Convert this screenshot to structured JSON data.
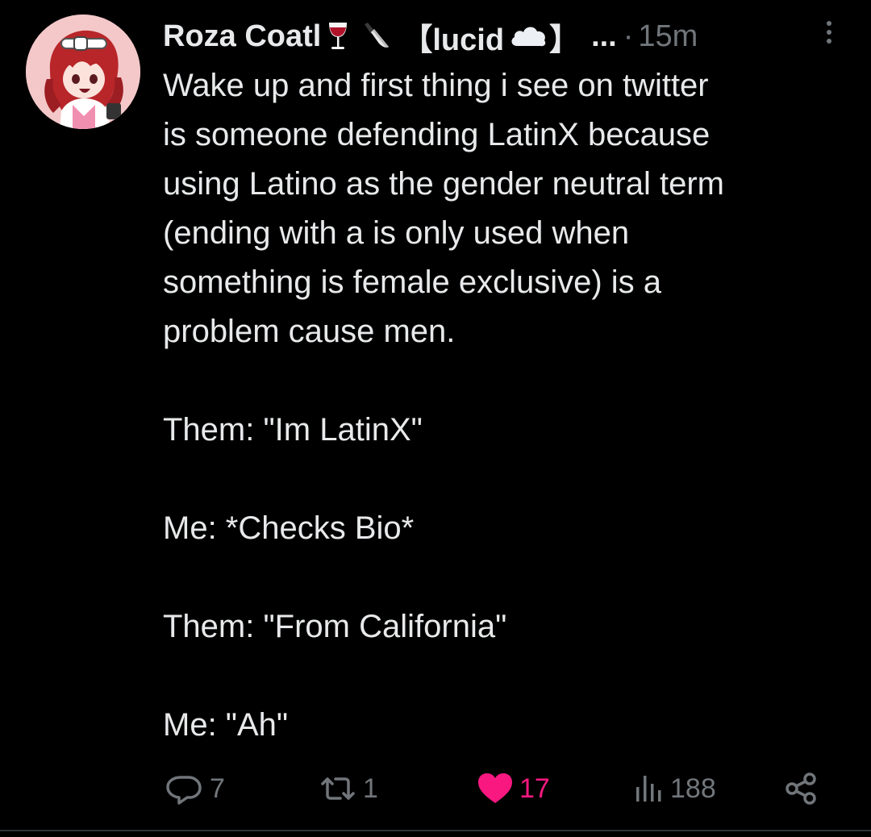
{
  "tweet": {
    "author_name": "Roza Coatl",
    "name_emoji_1": "wine-glass",
    "name_emoji_2": "knife",
    "bracket_text": "【lucid",
    "bracket_emoji": "cloud",
    "bracket_close": "】",
    "truncation": "...",
    "separator": "·",
    "timestamp": "15m",
    "body_lines": [
      "Wake up and first thing i see on twitter",
      "is someone defending LatinX because",
      "using Latino as the gender neutral term",
      "(ending with a is only used when",
      "something is female exclusive) is a",
      "problem cause men."
    ],
    "dialogue": [
      "Them: \"Im LatinX\"",
      "Me: *Checks Bio*",
      "Them: \"From California\"",
      "Me: \"Ah\""
    ]
  },
  "actions": {
    "reply_count": "7",
    "repost_count": "1",
    "like_count": "17",
    "view_count": "188"
  },
  "colors": {
    "background": "#000000",
    "text": "#e7e9ea",
    "muted": "#71767b",
    "like": "#f91880",
    "divider": "#2f3336"
  }
}
